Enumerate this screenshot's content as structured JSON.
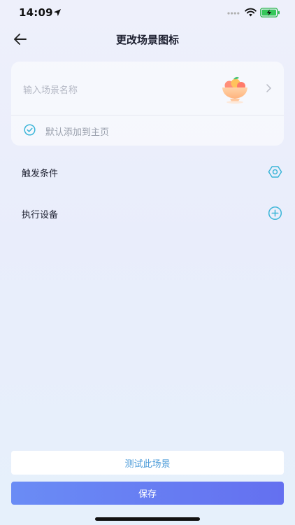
{
  "status_bar": {
    "time": "14:09"
  },
  "header": {
    "title": "更改场景图标"
  },
  "scene": {
    "name_placeholder": "输入场景名称",
    "default_add_label": "默认添加到主页"
  },
  "sections": {
    "trigger_label": "触发条件",
    "device_label": "执行设备"
  },
  "footer": {
    "test_label": "测试此场景",
    "save_label": "保存"
  },
  "colors": {
    "accent": "#3bb5d8",
    "save_button": "#6a7ff2",
    "test_text": "#4a9ad8"
  }
}
